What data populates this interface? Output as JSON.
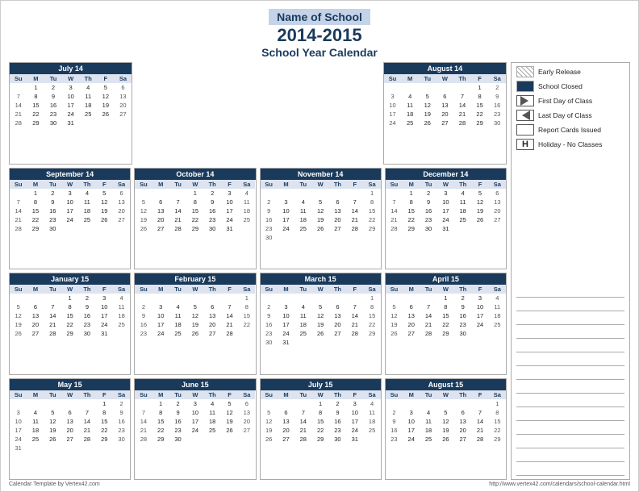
{
  "header": {
    "school_name": "Name of School",
    "year": "2014-2015",
    "subtitle": "School Year Calendar"
  },
  "footer": {
    "left": "Calendar Template by Vertex42.com",
    "right": "http://www.vertex42.com/calendars/school-calendar.html"
  },
  "legend": {
    "items": [
      {
        "icon": "hatch",
        "text": "Early Release"
      },
      {
        "icon": "solid-blue",
        "text": "School Closed"
      },
      {
        "icon": "triangle-right",
        "text": "First Day of Class"
      },
      {
        "icon": "triangle-left",
        "text": "Last Day of Class"
      },
      {
        "icon": "square",
        "text": "Report Cards Issued"
      },
      {
        "icon": "h-box",
        "text": "Holiday - No Classes"
      }
    ]
  },
  "months": [
    {
      "name": "July 14",
      "days": [
        "",
        "1",
        "2",
        "3",
        "4",
        "5",
        "6",
        "7",
        "8",
        "9",
        "10",
        "11",
        "12",
        "13",
        "14",
        "15",
        "16",
        "17",
        "18",
        "19",
        "20",
        "21",
        "22",
        "23",
        "24",
        "25",
        "26",
        "27",
        "28",
        "29",
        "30",
        "31"
      ]
    },
    {
      "name": "August 14",
      "days": [
        "",
        "",
        "",
        "",
        "",
        "1",
        "2",
        "3",
        "4",
        "5",
        "6",
        "7",
        "8",
        "9",
        "10",
        "11",
        "12",
        "13",
        "14",
        "15",
        "16",
        "17",
        "18",
        "19",
        "20",
        "21",
        "22",
        "23",
        "24",
        "25",
        "26",
        "27",
        "28",
        "29",
        "30"
      ]
    },
    {
      "name": "September 14",
      "days": [
        "",
        "1",
        "2",
        "3",
        "4",
        "5",
        "6",
        "7",
        "8",
        "9",
        "10",
        "11",
        "12",
        "13",
        "14",
        "15",
        "16",
        "17",
        "18",
        "19",
        "20",
        "21",
        "22",
        "23",
        "24",
        "25",
        "26",
        "27",
        "28",
        "29",
        "30"
      ]
    },
    {
      "name": "October 14",
      "days": [
        "",
        "",
        "",
        "1",
        "2",
        "3",
        "4",
        "5",
        "6",
        "7",
        "8",
        "9",
        "10",
        "11",
        "12",
        "13",
        "14",
        "15",
        "16",
        "17",
        "18",
        "19",
        "20",
        "21",
        "22",
        "23",
        "24",
        "25",
        "26",
        "27",
        "28",
        "29",
        "30",
        "31"
      ]
    },
    {
      "name": "November 14",
      "days": [
        "",
        "",
        "",
        "",
        "",
        "",
        "1",
        "2",
        "3",
        "4",
        "5",
        "6",
        "7",
        "8",
        "9",
        "10",
        "11",
        "12",
        "13",
        "14",
        "15",
        "16",
        "17",
        "18",
        "19",
        "20",
        "21",
        "22",
        "23",
        "24",
        "25",
        "26",
        "27",
        "28",
        "29",
        "30"
      ]
    },
    {
      "name": "December 14",
      "days": [
        "",
        "1",
        "2",
        "3",
        "4",
        "5",
        "6",
        "7",
        "8",
        "9",
        "10",
        "11",
        "12",
        "13",
        "14",
        "15",
        "16",
        "17",
        "18",
        "19",
        "20",
        "21",
        "22",
        "23",
        "24",
        "25",
        "26",
        "27",
        "28",
        "29",
        "30",
        "31"
      ]
    },
    {
      "name": "January 15",
      "days": [
        "",
        "",
        "",
        "1",
        "2",
        "3",
        "4",
        "5",
        "6",
        "7",
        "8",
        "9",
        "10",
        "11",
        "12",
        "13",
        "14",
        "15",
        "16",
        "17",
        "18",
        "19",
        "20",
        "21",
        "22",
        "23",
        "24",
        "25",
        "26",
        "27",
        "28",
        "29",
        "30",
        "31"
      ]
    },
    {
      "name": "February 15",
      "days": [
        "",
        "",
        "",
        "",
        "",
        "",
        "1",
        "2",
        "3",
        "4",
        "5",
        "6",
        "7",
        "8",
        "9",
        "10",
        "11",
        "12",
        "13",
        "14",
        "15",
        "16",
        "17",
        "18",
        "19",
        "20",
        "21",
        "22",
        "23",
        "24",
        "25",
        "26",
        "27",
        "28"
      ]
    },
    {
      "name": "March 15",
      "days": [
        "",
        "",
        "",
        "",
        "",
        "",
        "1",
        "2",
        "3",
        "4",
        "5",
        "6",
        "7",
        "8",
        "9",
        "10",
        "11",
        "12",
        "13",
        "14",
        "15",
        "16",
        "17",
        "18",
        "19",
        "20",
        "21",
        "22",
        "23",
        "24",
        "25",
        "26",
        "27",
        "28",
        "29",
        "30",
        "31"
      ]
    },
    {
      "name": "April 15",
      "days": [
        "",
        "",
        "",
        "1",
        "2",
        "3",
        "4",
        "5",
        "6",
        "7",
        "8",
        "9",
        "10",
        "11",
        "12",
        "13",
        "14",
        "15",
        "16",
        "17",
        "18",
        "19",
        "20",
        "21",
        "22",
        "23",
        "24",
        "25",
        "26",
        "27",
        "28",
        "29",
        "30"
      ]
    },
    {
      "name": "May 15",
      "days": [
        "",
        "",
        "",
        "",
        "",
        "1",
        "2",
        "3",
        "4",
        "5",
        "6",
        "7",
        "8",
        "9",
        "10",
        "11",
        "12",
        "13",
        "14",
        "15",
        "16",
        "17",
        "18",
        "19",
        "20",
        "21",
        "22",
        "23",
        "24",
        "25",
        "26",
        "27",
        "28",
        "29",
        "30",
        "31"
      ]
    },
    {
      "name": "June 15",
      "days": [
        "",
        "1",
        "2",
        "3",
        "4",
        "5",
        "6",
        "7",
        "8",
        "9",
        "10",
        "11",
        "12",
        "13",
        "14",
        "15",
        "16",
        "17",
        "18",
        "19",
        "20",
        "21",
        "22",
        "23",
        "24",
        "25",
        "26",
        "27",
        "28",
        "29",
        "30"
      ]
    },
    {
      "name": "July 15",
      "days": [
        "",
        "",
        "",
        "1",
        "2",
        "3",
        "4",
        "5",
        "6",
        "7",
        "8",
        "9",
        "10",
        "11",
        "12",
        "13",
        "14",
        "15",
        "16",
        "17",
        "18",
        "19",
        "20",
        "21",
        "22",
        "23",
        "24",
        "25",
        "26",
        "27",
        "28",
        "29",
        "30",
        "31"
      ]
    },
    {
      "name": "August 15",
      "days": [
        "",
        "",
        "",
        "",
        "",
        "",
        "1",
        "2",
        "3",
        "4",
        "5",
        "6",
        "7",
        "8",
        "9",
        "10",
        "11",
        "12",
        "13",
        "14",
        "15",
        "16",
        "17",
        "18",
        "19",
        "20",
        "21",
        "22",
        "23",
        "24",
        "25",
        "26",
        "27",
        "28",
        "29"
      ]
    }
  ]
}
